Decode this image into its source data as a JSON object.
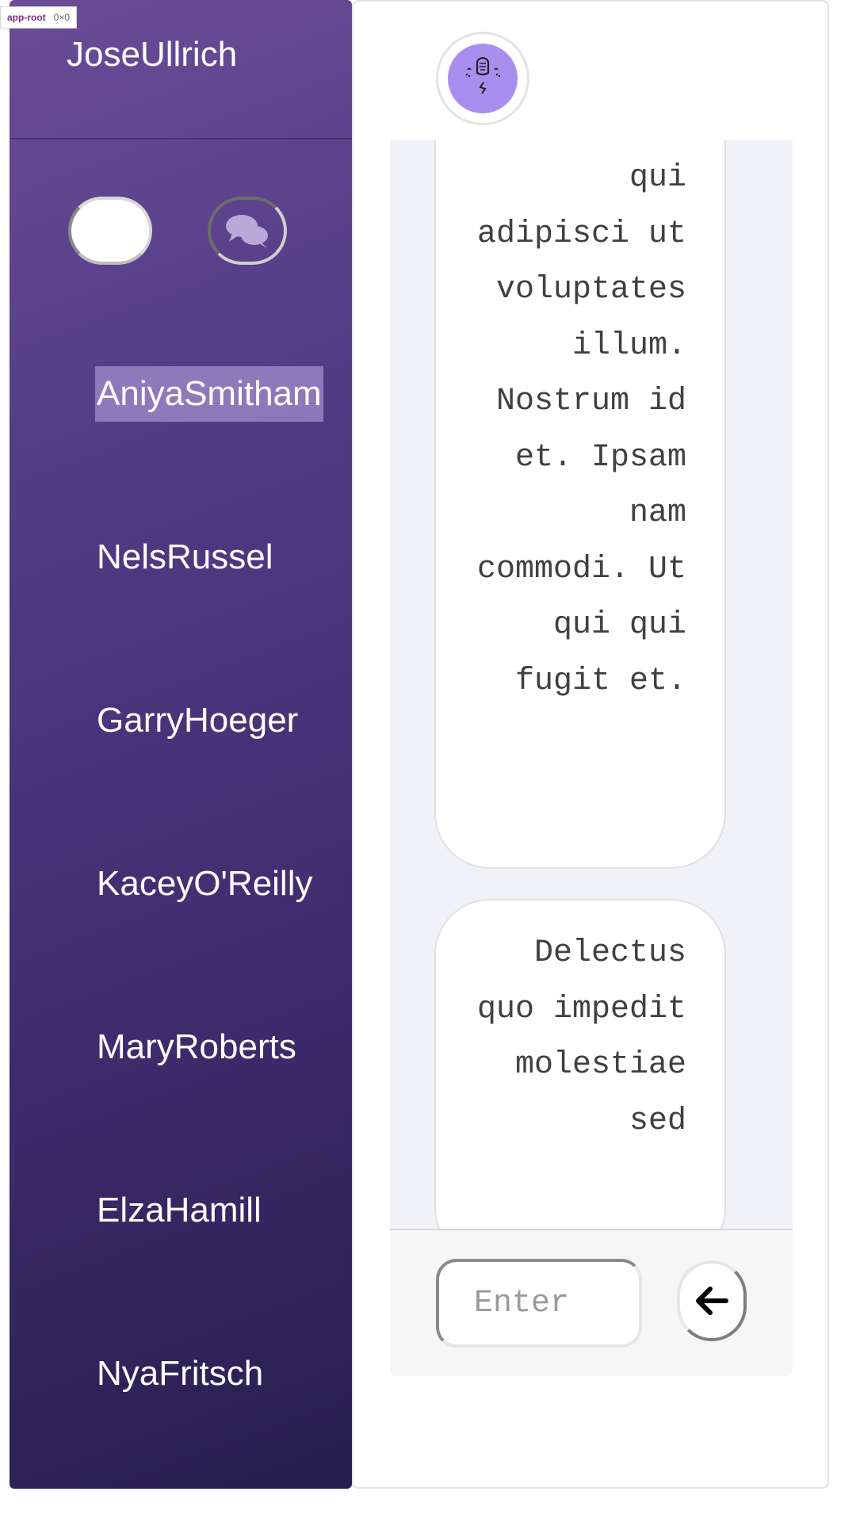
{
  "debug_tag": {
    "name": "app-root",
    "dims": "0×0"
  },
  "sidebar": {
    "user_name": "JoseUllrich",
    "contacts": [
      {
        "name": "AniyaSmitham",
        "active": true
      },
      {
        "name": "NelsRussel",
        "active": false
      },
      {
        "name": "GarryHoeger",
        "active": false
      },
      {
        "name": "KaceyO'Reilly",
        "active": false
      },
      {
        "name": "MaryRoberts",
        "active": false
      },
      {
        "name": "ElzaHamill",
        "active": false
      },
      {
        "name": "NyaFritsch",
        "active": false
      }
    ]
  },
  "chat": {
    "messages": [
      {
        "text": "qui adipisci ut voluptates illum. Nostrum id et. Ipsam nam commodi. Ut qui qui fugit et."
      },
      {
        "text": "Delectus quo impedit molestiae sed"
      }
    ]
  },
  "composer": {
    "placeholder": "Enter",
    "value": ""
  },
  "colors": {
    "sidebar_top": "#6a4c97",
    "sidebar_bottom": "#261e4e",
    "avatar_bg": "#a98ef0",
    "active_highlight": "#beace6",
    "chat_bg": "#f1f2f7"
  }
}
